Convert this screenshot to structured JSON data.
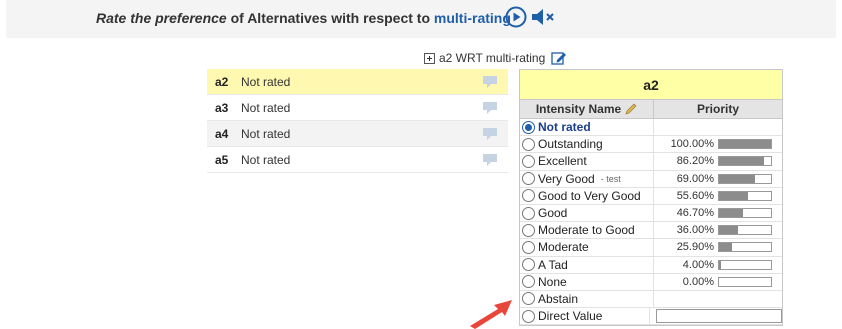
{
  "header": {
    "part1": "Rate the preference",
    "part2": " of Alternatives with respect to ",
    "link": "multi-rating",
    "play_icon": "play-circle-icon",
    "mute_icon": "speaker-mute-icon"
  },
  "wrt": {
    "label": "a2 WRT multi-rating",
    "expand_icon": "plus-box-icon",
    "edit_icon": "edit-note-icon"
  },
  "alternatives": [
    {
      "name": "a2",
      "status": "Not rated",
      "selected": true
    },
    {
      "name": "a3",
      "status": "Not rated",
      "selected": false
    },
    {
      "name": "a4",
      "status": "Not rated",
      "selected": false
    },
    {
      "name": "a5",
      "status": "Not rated",
      "selected": false
    }
  ],
  "rating_table": {
    "title": "a2",
    "col_intensity": "Intensity Name",
    "col_priority": "Priority",
    "rows": [
      {
        "name": "Not rated",
        "priority": "",
        "fraction": null,
        "checked": true
      },
      {
        "name": "Outstanding",
        "priority": "100.00%",
        "fraction": 1.0,
        "checked": false
      },
      {
        "name": "Excellent",
        "priority": "86.20%",
        "fraction": 0.862,
        "checked": false
      },
      {
        "name": "Very Good",
        "sub": "- test",
        "priority": "69.00%",
        "fraction": 0.69,
        "checked": false
      },
      {
        "name": "Good to Very Good",
        "priority": "55.60%",
        "fraction": 0.556,
        "checked": false
      },
      {
        "name": "Good",
        "priority": "46.70%",
        "fraction": 0.467,
        "checked": false
      },
      {
        "name": "Moderate to Good",
        "priority": "36.00%",
        "fraction": 0.36,
        "checked": false
      },
      {
        "name": "Moderate",
        "priority": "25.90%",
        "fraction": 0.259,
        "checked": false
      },
      {
        "name": "A Tad",
        "priority": "4.00%",
        "fraction": 0.04,
        "checked": false
      },
      {
        "name": "None",
        "priority": "0.00%",
        "fraction": 0.0,
        "checked": false
      },
      {
        "name": "Abstain",
        "priority": "",
        "fraction": null,
        "checked": false
      },
      {
        "name": "Direct Value",
        "priority": "",
        "fraction": null,
        "checked": false,
        "input": true
      }
    ]
  },
  "colors": {
    "accent": "#1f5ea8",
    "selected_row": "#fff8b0",
    "table_title_bg": "#ffffa6",
    "arrow": "#e8463a"
  }
}
